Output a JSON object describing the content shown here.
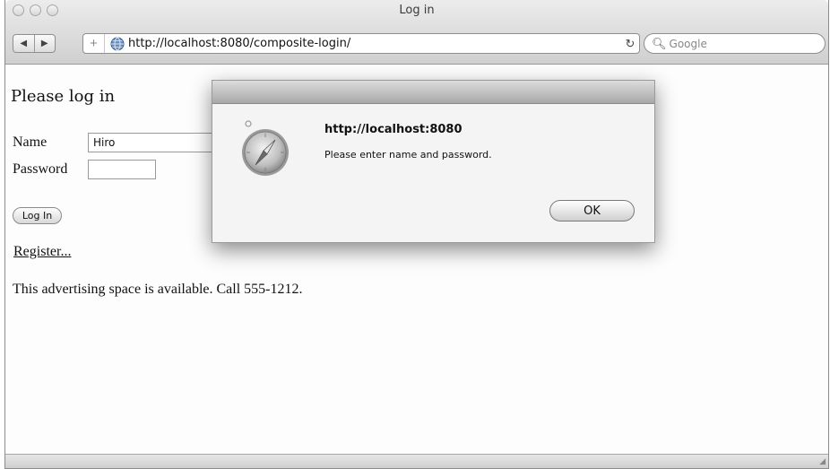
{
  "window": {
    "title": "Log in"
  },
  "toolbar": {
    "back_icon": "back-arrow-icon",
    "forward_icon": "forward-arrow-icon",
    "add_bookmark_icon": "plus-icon",
    "url": "http://localhost:8080/composite-login/",
    "reload_icon": "reload-icon",
    "search_placeholder": "Google"
  },
  "page": {
    "heading": "Please log in",
    "name_label": "Name",
    "name_value": "Hiro",
    "password_label": "Password",
    "password_value": "",
    "login_button": "Log In",
    "register_link": "Register...",
    "ad_text": "This advertising space is available. Call 555-1212."
  },
  "dialog": {
    "title": "http://localhost:8080",
    "message": "Please enter name and password.",
    "ok_button": "OK",
    "icon": "safari-compass-icon"
  }
}
